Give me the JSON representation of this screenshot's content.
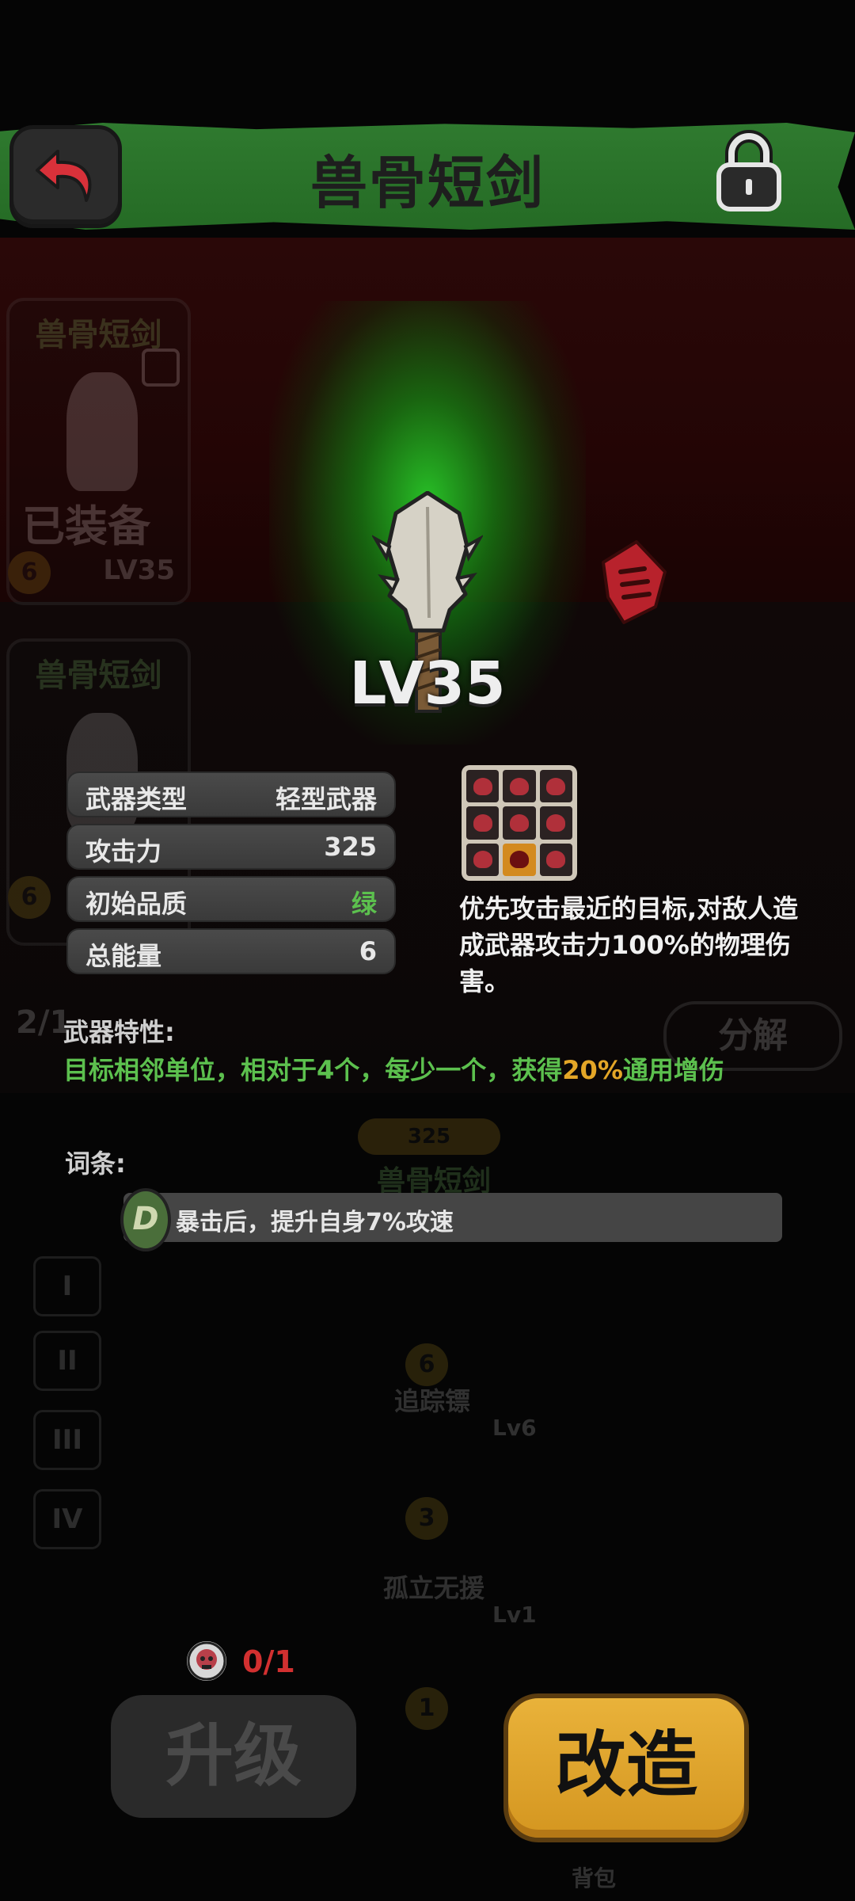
{
  "header": {
    "title": "兽骨短剑",
    "back_icon": "back-arrow-icon",
    "lock_icon": "padlock-icon",
    "accent": "#2f7a2f"
  },
  "background": {
    "card1": {
      "title": "兽骨短剑",
      "status": "已装备",
      "level": "LV35",
      "badge": "6"
    },
    "card2": {
      "title": "兽骨短剑",
      "badge": "6"
    },
    "page_indicator": "2/1",
    "decompose": "分解",
    "tree_attack": "325",
    "tree_name": "兽骨短剑",
    "tree_node_a_num": "6",
    "tree_node_a_name": "追踪镖",
    "tree_node_a_lv": "Lv6",
    "tree_node_b_num": "3",
    "tree_node_b_name": "孤立无援",
    "tree_node_b_lv": "Lv1",
    "tree_node_c_num": "1",
    "roman": [
      "I",
      "II",
      "III",
      "IV"
    ],
    "nav_backpack": "背包"
  },
  "weapon": {
    "level": "LV35",
    "glow_color": "#28c828"
  },
  "stats": [
    {
      "label": "武器类型",
      "value": "轻型武器"
    },
    {
      "label": "攻击力",
      "value": "325"
    },
    {
      "label": "初始品质",
      "value": "绿",
      "color": "#5cc04e"
    },
    {
      "label": "总能量",
      "value": "6"
    }
  ],
  "description": "优先攻击最近的目标,对敌人造成武器攻击力100%的物理伤害。",
  "trait": {
    "label": "武器特性:",
    "text_a": "目标相邻单位，相对于4个，每少一个，获得",
    "highlight": "20%",
    "text_b": "通用增伤",
    "color": "#5cc04e",
    "highlight_color": "#e3a627"
  },
  "affix": {
    "label": "词条:",
    "badge": "D",
    "text": "暴击后，提升自身7%攻速"
  },
  "upgrade": {
    "material_icon": "skull-token-icon",
    "count": "0/1",
    "upgrade_label": "升级",
    "reforge_label": "改造"
  }
}
